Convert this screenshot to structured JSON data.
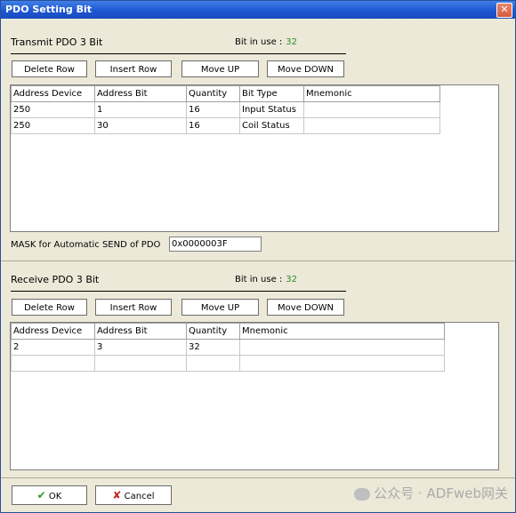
{
  "window": {
    "title": "PDO Setting Bit",
    "close_label": "✕"
  },
  "transmit": {
    "title": "Transmit PDO 3 Bit",
    "bit_in_use_label": "Bit in use :",
    "bit_in_use_value": "32",
    "buttons": {
      "delete": "Delete Row",
      "insert": "Insert Row",
      "move_up": "Move UP",
      "move_down": "Move DOWN"
    },
    "headers": [
      "Address Device",
      "Address Bit",
      "Quantity",
      "Bit Type",
      "Mnemonic"
    ],
    "rows": [
      [
        "250",
        "1",
        "16",
        "Input Status",
        ""
      ],
      [
        "250",
        "30",
        "16",
        "Coil Status",
        ""
      ]
    ],
    "mask_label": "MASK for Automatic SEND of PDO",
    "mask_value": "0x0000003F"
  },
  "receive": {
    "title": "Receive PDO 3 Bit",
    "bit_in_use_label": "Bit in use :",
    "bit_in_use_value": "32",
    "buttons": {
      "delete": "Delete Row",
      "insert": "Insert Row",
      "move_up": "Move UP",
      "move_down": "Move DOWN"
    },
    "headers": [
      "Address Device",
      "Address Bit",
      "Quantity",
      "Mnemonic"
    ],
    "rows": [
      [
        "2",
        "3",
        "32",
        ""
      ],
      [
        "",
        "",
        "",
        ""
      ]
    ]
  },
  "footer": {
    "ok_label": "OK",
    "cancel_label": "Cancel"
  },
  "watermark": {
    "text": "公众号 · ADFweb网关"
  },
  "colors": {
    "titlebar": "#1c55d0",
    "bit_value": "#2e8b2e",
    "dialog_bg": "#ece9d8"
  }
}
